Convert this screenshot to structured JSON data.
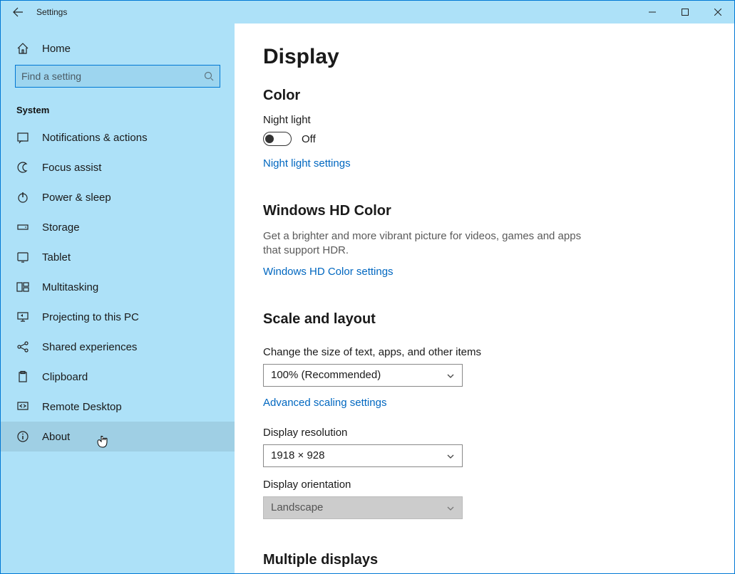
{
  "window": {
    "title": "Settings"
  },
  "sidebar": {
    "home_label": "Home",
    "search_placeholder": "Find a setting",
    "section_label": "System",
    "items": [
      {
        "icon": "notifications",
        "label": "Notifications & actions"
      },
      {
        "icon": "focus",
        "label": "Focus assist"
      },
      {
        "icon": "power",
        "label": "Power & sleep"
      },
      {
        "icon": "storage",
        "label": "Storage"
      },
      {
        "icon": "tablet",
        "label": "Tablet"
      },
      {
        "icon": "multitask",
        "label": "Multitasking"
      },
      {
        "icon": "project",
        "label": "Projecting to this PC"
      },
      {
        "icon": "shared",
        "label": "Shared experiences"
      },
      {
        "icon": "clipboard",
        "label": "Clipboard"
      },
      {
        "icon": "remote",
        "label": "Remote Desktop"
      },
      {
        "icon": "about",
        "label": "About"
      }
    ]
  },
  "content": {
    "page_title": "Display",
    "color": {
      "heading": "Color",
      "night_light_label": "Night light",
      "night_light_state": "Off",
      "night_light_link": "Night light settings"
    },
    "hdcolor": {
      "heading": "Windows HD Color",
      "desc": "Get a brighter and more vibrant picture for videos, games and apps that support HDR.",
      "link": "Windows HD Color settings"
    },
    "scale": {
      "heading": "Scale and layout",
      "text_size_label": "Change the size of text, apps, and other items",
      "text_size_value": "100% (Recommended)",
      "adv_link": "Advanced scaling settings",
      "resolution_label": "Display resolution",
      "resolution_value": "1918 × 928",
      "orientation_label": "Display orientation",
      "orientation_value": "Landscape"
    },
    "multiple": {
      "heading": "Multiple displays"
    }
  }
}
